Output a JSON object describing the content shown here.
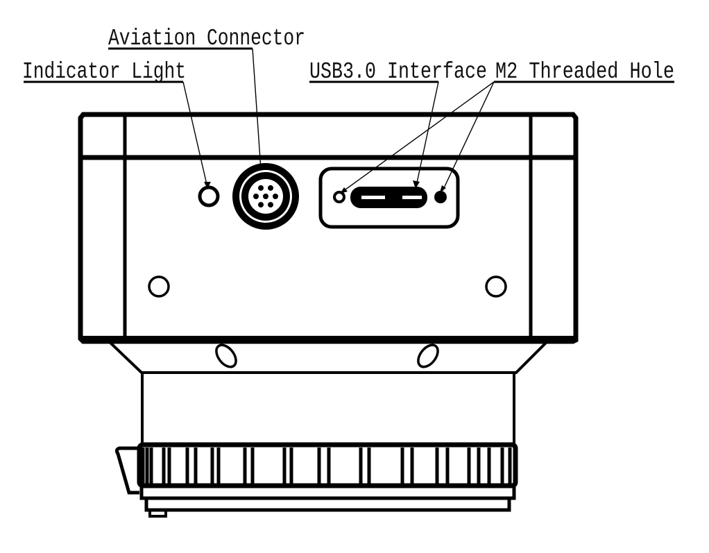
{
  "diagram": {
    "subject": "camera rear panel technical drawing",
    "colors": {
      "line": "#000000",
      "background": "#ffffff"
    },
    "callouts": [
      {
        "id": "indicator-light",
        "text": "Indicator Light"
      },
      {
        "id": "aviation-connector",
        "text": "Aviation Connector"
      },
      {
        "id": "usb3-interface",
        "text": "USB3.0 Interface"
      },
      {
        "id": "m2-threaded-hole",
        "text": "M2 Threaded Hole"
      }
    ],
    "aviation_connector_pins": 7
  }
}
